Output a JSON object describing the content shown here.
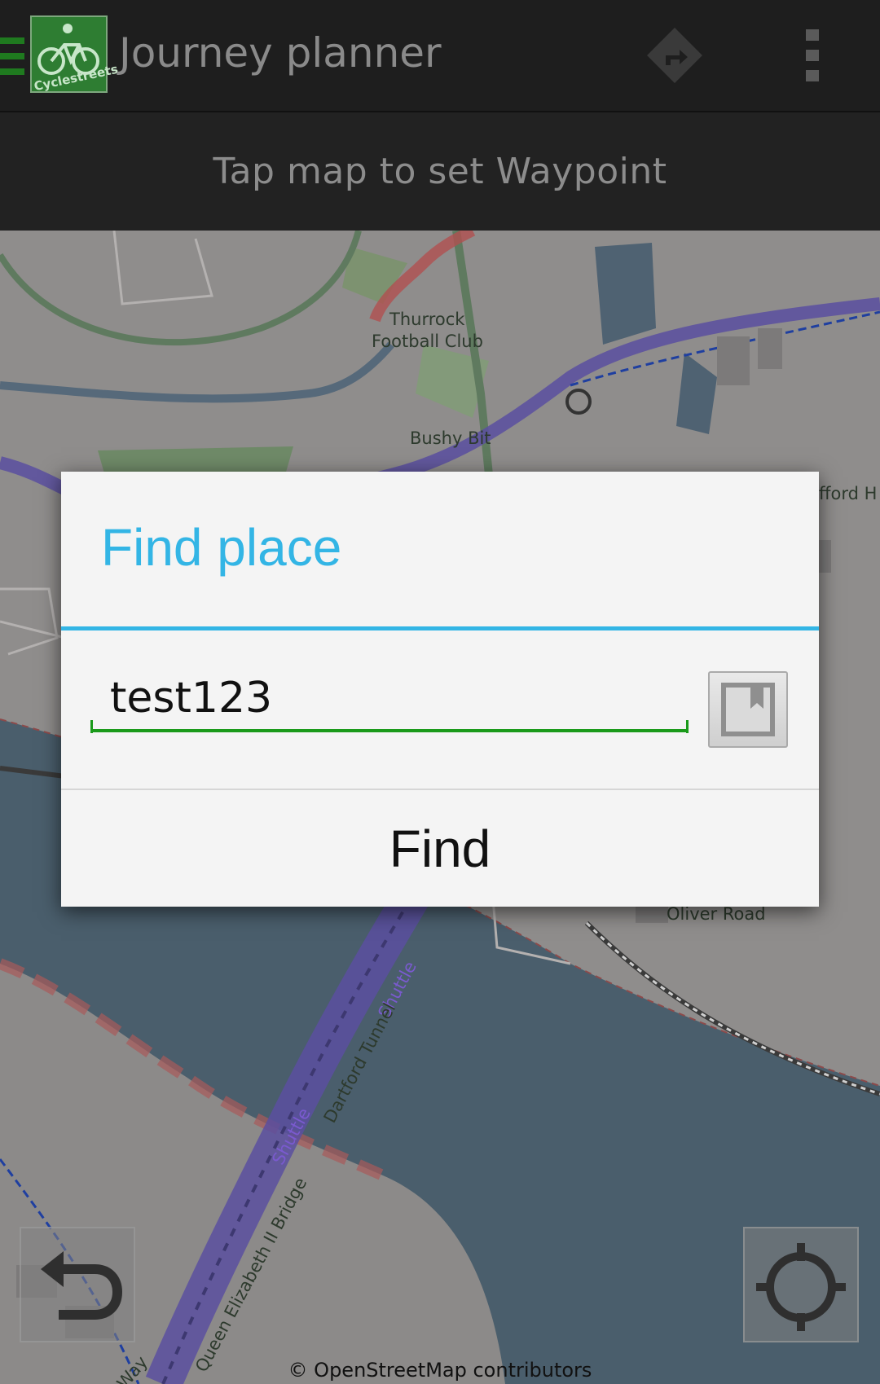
{
  "app_bar": {
    "title": "Journey planner",
    "logo_text": "Cyclestreets",
    "icons": [
      "drawer-toggle-icon",
      "directions-icon",
      "overflow-menu-icon"
    ]
  },
  "hint": {
    "text": "Tap map to set Waypoint"
  },
  "map": {
    "labels": {
      "thurrock_line1": "Thurrock",
      "thurrock_line2": "Football Club",
      "bushy_bit": "Bushy Bit",
      "fford": "fford H",
      "oliver_road": "Oliver Road",
      "shuttle1": "Shuttle",
      "shuttle2": "Shuttle",
      "dartford_tunnel": "Dartford Tunnel",
      "qe_bridge": "Queen Elizabeth II Bridge",
      "way": "Way"
    },
    "attribution": "© OpenStreetMap contributors",
    "colors": {
      "water": "#4a5e6c",
      "land": "#9a9392",
      "route": "#5a4a9a"
    }
  },
  "dialog": {
    "title": "Find place",
    "input_value": "test123",
    "find_label": "Find",
    "accent": "#33b5e5",
    "input_underline": "#1a9a1a"
  },
  "buttons": {
    "back_icon": "undo-arrow-icon",
    "locate_icon": "crosshair-locate-icon"
  }
}
